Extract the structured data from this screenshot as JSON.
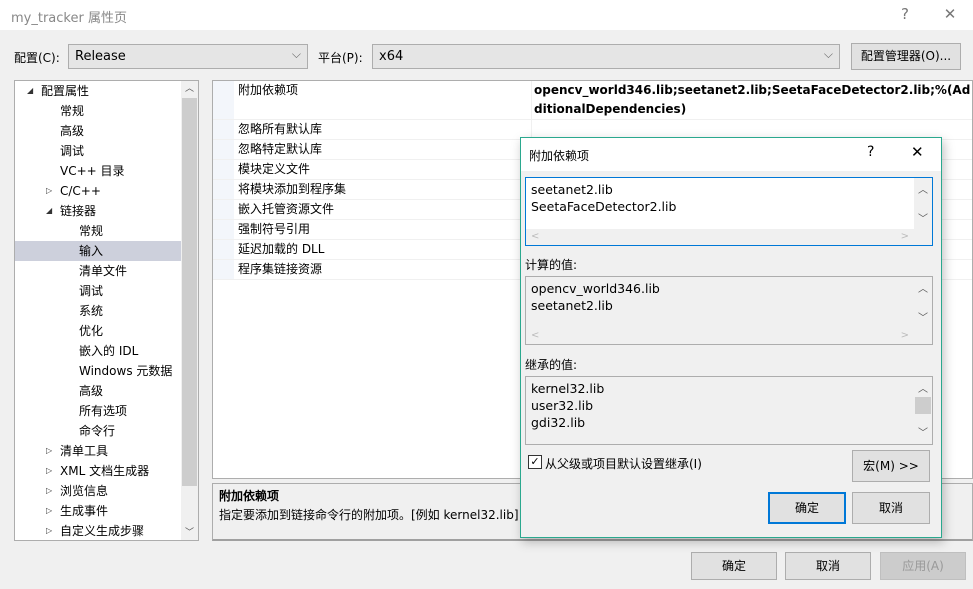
{
  "window": {
    "title": "my_tracker 属性页",
    "help": "?",
    "close": "✕"
  },
  "toolbar": {
    "config_label": "配置(C):",
    "config_value": "Release",
    "platform_label": "平台(P):",
    "platform_value": "x64",
    "config_manager": "配置管理器(O)..."
  },
  "tree": {
    "items": [
      {
        "label": "配置属性",
        "level": 0,
        "expander": "expanded"
      },
      {
        "label": "常规",
        "level": 1
      },
      {
        "label": "高级",
        "level": 1
      },
      {
        "label": "调试",
        "level": 1
      },
      {
        "label": "VC++ 目录",
        "level": 1
      },
      {
        "label": "C/C++",
        "level": 1,
        "expander": "collapsed"
      },
      {
        "label": "链接器",
        "level": 1,
        "expander": "expanded"
      },
      {
        "label": "常规",
        "level": 2
      },
      {
        "label": "输入",
        "level": 2,
        "selected": true
      },
      {
        "label": "清单文件",
        "level": 2
      },
      {
        "label": "调试",
        "level": 2
      },
      {
        "label": "系统",
        "level": 2
      },
      {
        "label": "优化",
        "level": 2
      },
      {
        "label": "嵌入的 IDL",
        "level": 2
      },
      {
        "label": "Windows 元数据",
        "level": 2
      },
      {
        "label": "高级",
        "level": 2
      },
      {
        "label": "所有选项",
        "level": 2
      },
      {
        "label": "命令行",
        "level": 2
      },
      {
        "label": "清单工具",
        "level": 1,
        "expander": "collapsed"
      },
      {
        "label": "XML 文档生成器",
        "level": 1,
        "expander": "collapsed"
      },
      {
        "label": "浏览信息",
        "level": 1,
        "expander": "collapsed"
      },
      {
        "label": "生成事件",
        "level": 1,
        "expander": "collapsed"
      },
      {
        "label": "自定义生成步骤",
        "level": 1,
        "expander": "collapsed"
      }
    ]
  },
  "grid": {
    "rows": [
      {
        "label": "附加依赖项",
        "value": "opencv_world346.lib;seetanet2.lib;SeetaFaceDetector2.lib;%(AdditionalDependencies)"
      },
      {
        "label": "忽略所有默认库",
        "value": ""
      },
      {
        "label": "忽略特定默认库",
        "value": ""
      },
      {
        "label": "模块定义文件",
        "value": ""
      },
      {
        "label": "将模块添加到程序集",
        "value": ""
      },
      {
        "label": "嵌入托管资源文件",
        "value": ""
      },
      {
        "label": "强制符号引用",
        "value": ""
      },
      {
        "label": "延迟加载的 DLL",
        "value": ""
      },
      {
        "label": "程序集链接资源",
        "value": ""
      }
    ]
  },
  "description": {
    "title": "附加依赖项",
    "text": "指定要添加到链接命令行的附加项。[例如 kernel32.lib]"
  },
  "dialog": {
    "title": "附加依赖项",
    "help": "?",
    "close": "✕",
    "edit_lines": [
      "seetanet2.lib",
      "SeetaFaceDetector2.lib"
    ],
    "computed_label": "计算的值:",
    "computed_lines": [
      "opencv_world346.lib",
      "seetanet2.lib"
    ],
    "inherited_label": "继承的值:",
    "inherited_lines": [
      "kernel32.lib",
      "user32.lib",
      "gdi32.lib"
    ],
    "inherit_checkbox": "从父级或项目默认设置继承(I)",
    "inherit_checked": true,
    "macro_button": "宏(M) >>",
    "ok": "确定",
    "cancel": "取消"
  },
  "footer": {
    "ok": "确定",
    "cancel": "取消",
    "apply": "应用(A)"
  },
  "colors": {
    "accent": "#0078d7",
    "dialog_border": "#2aa88e",
    "selection": "#cdd0dc"
  }
}
